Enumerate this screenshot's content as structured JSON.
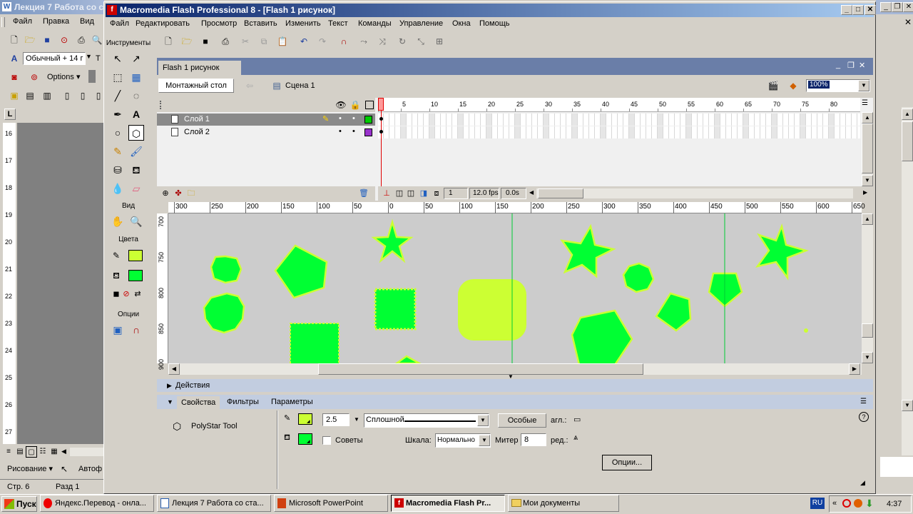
{
  "bg_window": {
    "title": "Лекция 7 Работа со с",
    "menu": [
      "Файл",
      "Правка",
      "Вид"
    ],
    "style_value": "Обычный + 14 г",
    "font_value": "Т",
    "options_label": "Options",
    "status_page": "Стр. 6",
    "status_section": "Разд 1",
    "drawing_label": "Рисование",
    "autoshapes_label": "Автоф",
    "vruler_labels": [
      "16",
      "17",
      "18",
      "19",
      "20",
      "21",
      "22",
      "23",
      "24",
      "25",
      "26",
      "27"
    ]
  },
  "flash": {
    "title": "Macromedia Flash Professional 8 - [Flash 1 рисунок]",
    "menu": [
      "Файл",
      "Редактировать",
      "Просмотр",
      "Вставить",
      "Изменить",
      "Текст",
      "Команды",
      "Управление",
      "Окна",
      "Помощь"
    ],
    "tools_title": "Инструменты",
    "view_label": "Вид",
    "colors_label": "Цвета",
    "options_label": "Опции",
    "doc_tab": "Flash 1 рисунок",
    "stage_button": "Монтажный стол",
    "scene_label": "Сцена 1",
    "zoom_value": "100%",
    "layers": [
      {
        "name": "Слой 1",
        "color": "#00cc00",
        "selected": true
      },
      {
        "name": "Слой 2",
        "color": "#9933cc",
        "selected": false
      }
    ],
    "frame_numbers": [
      "1",
      "5",
      "10",
      "15",
      "20",
      "25",
      "30",
      "35",
      "40",
      "45",
      "50",
      "55",
      "60",
      "65",
      "70",
      "75",
      "80"
    ],
    "timeline_status": {
      "frame": "1",
      "fps": "12.0 fps",
      "time": "0.0s"
    },
    "hruler_labels": [
      "300",
      "250",
      "200",
      "150",
      "100",
      "50",
      "0",
      "50",
      "100",
      "150",
      "200",
      "250",
      "300",
      "350",
      "400",
      "450",
      "500",
      "550",
      "600",
      "650"
    ],
    "vruler_labels": [
      "700",
      "750",
      "800",
      "850",
      "900"
    ],
    "actions_label": "Действия",
    "prop_tabs": [
      "Свойства",
      "Фильтры",
      "Параметры"
    ],
    "tool_name": "PolyStar Tool",
    "stroke_width": "2.5",
    "stroke_style": "Сплошной",
    "custom_button": "Особые",
    "cap_label": "агл.:",
    "hints_label": "Советы",
    "scale_label": "Шкала:",
    "scale_value": "Нормально",
    "miter_label": "Митер",
    "miter_value": "8",
    "join_label": "ред.:",
    "options_button": "Опции...",
    "stroke_color": "#ccff33",
    "fill_color": "#00ff33"
  },
  "taskbar": {
    "start_label": "Пуск",
    "items": [
      {
        "label": "Яндекс.Перевод - онла...",
        "active": false
      },
      {
        "label": "Лекция 7 Работа со ста...",
        "active": false
      },
      {
        "label": "Microsoft PowerPoint",
        "active": false
      },
      {
        "label": "Macromedia Flash Pr...",
        "active": true
      },
      {
        "label": "Мои документы",
        "active": false
      }
    ],
    "lang": "RU",
    "clock": "4:37"
  },
  "colors": {
    "title_active": "#0a246a",
    "taskbar": "#d4d0c8",
    "stage": "#cccccc",
    "shape_fill": "#00ff33",
    "shape_stroke": "#ccff33"
  }
}
